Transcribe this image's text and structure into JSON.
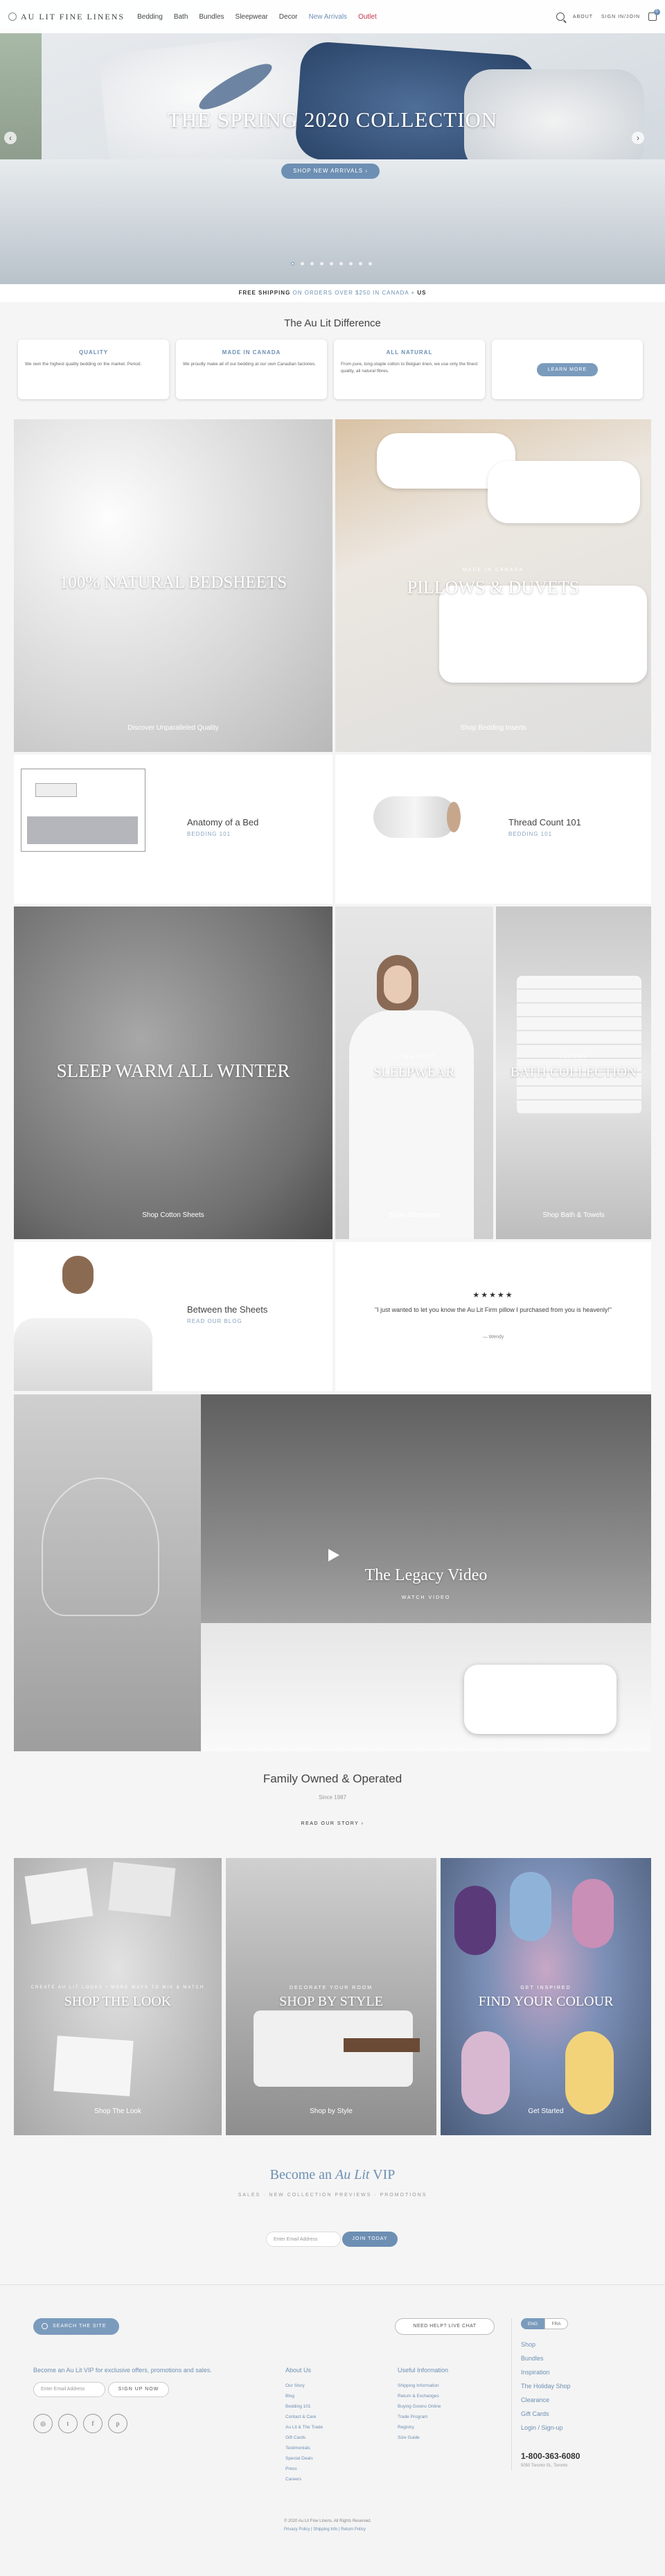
{
  "header": {
    "logo": "AU LIT FINE LINENS",
    "nav": [
      "Bedding",
      "Bath",
      "Bundles",
      "Sleepwear",
      "Decor",
      "New Arrivals",
      "Outlet"
    ],
    "right_links": [
      "ABOUT",
      "SIGN IN/JOIN"
    ],
    "cart_count": "0",
    "accent_color": "#6d8fb3",
    "outlet_color": "#c2334d"
  },
  "hero": {
    "title": "THE SPRING 2020 COLLECTION",
    "button": "SHOP NEW ARRIVALS",
    "prev": "‹",
    "next": "›"
  },
  "shipping": {
    "lead": "FREE SHIPPING",
    "highlight": "ON ORDERS OVER $250 IN CANADA +",
    "tail": "US"
  },
  "difference": {
    "title": "The Au Lit Difference",
    "cards": [
      {
        "heading": "QUALITY",
        "text": "We own the highest quality bedding on the market. Period."
      },
      {
        "heading": "MADE IN CANADA",
        "text": "We proudly make all of our bedding at our own Canadian factories."
      },
      {
        "heading": "ALL NATURAL",
        "text": "From pure, long-staple cotton to Belgian linen, we use only the finest quality, all natural fibres."
      }
    ],
    "cta": "LEARN MORE"
  },
  "tiles": {
    "bedsheets": {
      "title": "100% NATURAL BEDSHEETS",
      "link": "Discover Unparalleled Quality"
    },
    "pillows": {
      "kicker": "MADE IN CANADA",
      "title": "PILLOWS & DUVETS",
      "link": "Shop Bedding Inserts"
    },
    "anatomy": {
      "title": "Anatomy of a Bed",
      "sub": "BEDDING 101"
    },
    "thread": {
      "title": "Thread Count 101",
      "sub": "BEDDING 101"
    },
    "sleepwarm": {
      "title": "SLEEP WARM ALL WINTER",
      "link": "Shop Cotton Sheets"
    },
    "sleepwear": {
      "kicker": "ULTRA SOFT",
      "title": "SLEEPWEAR",
      "link": "Shop Sleepwear"
    },
    "bath": {
      "kicker": "LUXURY",
      "title": "BATH COLLECTION",
      "link": "Shop Bath & Towels"
    },
    "between": {
      "title": "Between the Sheets",
      "sub": "READ OUR BLOG"
    },
    "review": {
      "stars": "★★★★★",
      "quote": "\"I just wanted to let you know the Au Lit Firm pillow I purchased from you is heavenly!\"",
      "author": "— Wendy"
    },
    "video": {
      "title": "The Legacy Video",
      "link": "WATCH VIDEO"
    }
  },
  "family": {
    "title": "Family Owned & Operated",
    "sub": "Since 1987",
    "link": "READ OUR STORY"
  },
  "shop_tiles": [
    {
      "kicker": "CREATE AU LIT LOOKS • MORE WAYS TO MIX & MATCH",
      "title": "SHOP THE LOOK",
      "link": "Shop The Look"
    },
    {
      "kicker": "DECORATE YOUR ROOM",
      "title": "SHOP BY STYLE",
      "link": "Shop by Style"
    },
    {
      "kicker": "GET INSPIRED",
      "title": "FIND YOUR COLOUR",
      "link": "Get Started"
    }
  ],
  "vip": {
    "title_a": "Become an ",
    "title_b": "Au Lit",
    "title_c": " VIP",
    "sub": "SALES · NEW COLLECTION PREVIEWS · PROMOTIONS",
    "placeholder": "Enter Email Address",
    "button": "JOIN TODAY"
  },
  "footer": {
    "search": "SEARCH THE SITE",
    "chat": "NEED HELP? LIVE CHAT",
    "vip_line": "Become an Au Lit VIP for exclusive offers, promotions and sales.",
    "email_placeholder": "Enter Email Address",
    "signup": "SIGN UP NOW",
    "social": [
      "◎",
      "t",
      "f",
      "p"
    ],
    "about": {
      "title": "About Us",
      "links": [
        "Our Story",
        "Blog",
        "Bedding 101",
        "Contact & Care",
        "Au Lit & The Trade",
        "Gift Cards",
        "Testimonials",
        "Special Deals",
        "Press",
        "Careers"
      ]
    },
    "useful": {
      "title": "Useful Information",
      "links": [
        "Shipping Information",
        "Return & Exchanges",
        "Buying Gowns Online",
        "Trade Program",
        "Registry",
        "Size Guide"
      ]
    },
    "lang": [
      "ENG",
      "FRA"
    ],
    "quick": [
      "Shop",
      "Bundles",
      "Inspiration",
      "The Holiday Shop",
      "Clearance",
      "Gift Cards",
      "Login / Sign-up"
    ],
    "phone": "1-800-363-6080",
    "address": "5050 Toronto St., Toronto",
    "copyright": "© 2020 Au Lit Fine Linens. All Rights Reserved.",
    "legal": "Privacy Policy  |  Shipping Info  |  Return Policy"
  }
}
